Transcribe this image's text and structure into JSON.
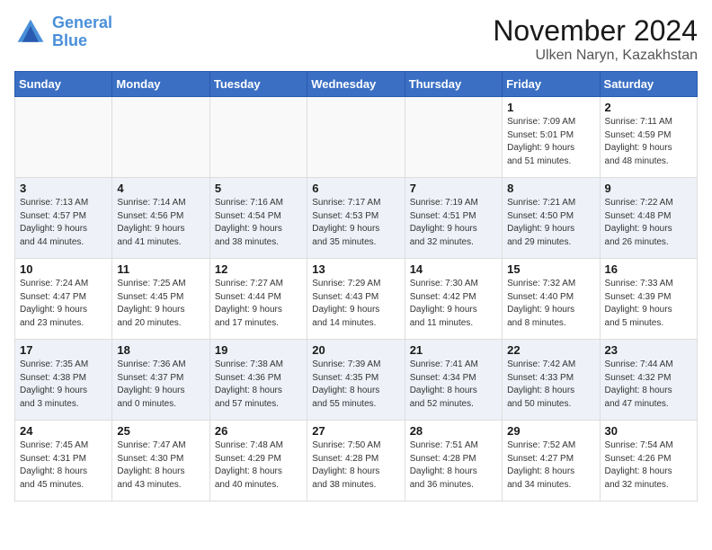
{
  "header": {
    "logo_line1": "General",
    "logo_line2": "Blue",
    "month": "November 2024",
    "location": "Ulken Naryn, Kazakhstan"
  },
  "weekdays": [
    "Sunday",
    "Monday",
    "Tuesday",
    "Wednesday",
    "Thursday",
    "Friday",
    "Saturday"
  ],
  "weeks": [
    [
      {
        "day": "",
        "info": ""
      },
      {
        "day": "",
        "info": ""
      },
      {
        "day": "",
        "info": ""
      },
      {
        "day": "",
        "info": ""
      },
      {
        "day": "",
        "info": ""
      },
      {
        "day": "1",
        "info": "Sunrise: 7:09 AM\nSunset: 5:01 PM\nDaylight: 9 hours\nand 51 minutes."
      },
      {
        "day": "2",
        "info": "Sunrise: 7:11 AM\nSunset: 4:59 PM\nDaylight: 9 hours\nand 48 minutes."
      }
    ],
    [
      {
        "day": "3",
        "info": "Sunrise: 7:13 AM\nSunset: 4:57 PM\nDaylight: 9 hours\nand 44 minutes."
      },
      {
        "day": "4",
        "info": "Sunrise: 7:14 AM\nSunset: 4:56 PM\nDaylight: 9 hours\nand 41 minutes."
      },
      {
        "day": "5",
        "info": "Sunrise: 7:16 AM\nSunset: 4:54 PM\nDaylight: 9 hours\nand 38 minutes."
      },
      {
        "day": "6",
        "info": "Sunrise: 7:17 AM\nSunset: 4:53 PM\nDaylight: 9 hours\nand 35 minutes."
      },
      {
        "day": "7",
        "info": "Sunrise: 7:19 AM\nSunset: 4:51 PM\nDaylight: 9 hours\nand 32 minutes."
      },
      {
        "day": "8",
        "info": "Sunrise: 7:21 AM\nSunset: 4:50 PM\nDaylight: 9 hours\nand 29 minutes."
      },
      {
        "day": "9",
        "info": "Sunrise: 7:22 AM\nSunset: 4:48 PM\nDaylight: 9 hours\nand 26 minutes."
      }
    ],
    [
      {
        "day": "10",
        "info": "Sunrise: 7:24 AM\nSunset: 4:47 PM\nDaylight: 9 hours\nand 23 minutes."
      },
      {
        "day": "11",
        "info": "Sunrise: 7:25 AM\nSunset: 4:45 PM\nDaylight: 9 hours\nand 20 minutes."
      },
      {
        "day": "12",
        "info": "Sunrise: 7:27 AM\nSunset: 4:44 PM\nDaylight: 9 hours\nand 17 minutes."
      },
      {
        "day": "13",
        "info": "Sunrise: 7:29 AM\nSunset: 4:43 PM\nDaylight: 9 hours\nand 14 minutes."
      },
      {
        "day": "14",
        "info": "Sunrise: 7:30 AM\nSunset: 4:42 PM\nDaylight: 9 hours\nand 11 minutes."
      },
      {
        "day": "15",
        "info": "Sunrise: 7:32 AM\nSunset: 4:40 PM\nDaylight: 9 hours\nand 8 minutes."
      },
      {
        "day": "16",
        "info": "Sunrise: 7:33 AM\nSunset: 4:39 PM\nDaylight: 9 hours\nand 5 minutes."
      }
    ],
    [
      {
        "day": "17",
        "info": "Sunrise: 7:35 AM\nSunset: 4:38 PM\nDaylight: 9 hours\nand 3 minutes."
      },
      {
        "day": "18",
        "info": "Sunrise: 7:36 AM\nSunset: 4:37 PM\nDaylight: 9 hours\nand 0 minutes."
      },
      {
        "day": "19",
        "info": "Sunrise: 7:38 AM\nSunset: 4:36 PM\nDaylight: 8 hours\nand 57 minutes."
      },
      {
        "day": "20",
        "info": "Sunrise: 7:39 AM\nSunset: 4:35 PM\nDaylight: 8 hours\nand 55 minutes."
      },
      {
        "day": "21",
        "info": "Sunrise: 7:41 AM\nSunset: 4:34 PM\nDaylight: 8 hours\nand 52 minutes."
      },
      {
        "day": "22",
        "info": "Sunrise: 7:42 AM\nSunset: 4:33 PM\nDaylight: 8 hours\nand 50 minutes."
      },
      {
        "day": "23",
        "info": "Sunrise: 7:44 AM\nSunset: 4:32 PM\nDaylight: 8 hours\nand 47 minutes."
      }
    ],
    [
      {
        "day": "24",
        "info": "Sunrise: 7:45 AM\nSunset: 4:31 PM\nDaylight: 8 hours\nand 45 minutes."
      },
      {
        "day": "25",
        "info": "Sunrise: 7:47 AM\nSunset: 4:30 PM\nDaylight: 8 hours\nand 43 minutes."
      },
      {
        "day": "26",
        "info": "Sunrise: 7:48 AM\nSunset: 4:29 PM\nDaylight: 8 hours\nand 40 minutes."
      },
      {
        "day": "27",
        "info": "Sunrise: 7:50 AM\nSunset: 4:28 PM\nDaylight: 8 hours\nand 38 minutes."
      },
      {
        "day": "28",
        "info": "Sunrise: 7:51 AM\nSunset: 4:28 PM\nDaylight: 8 hours\nand 36 minutes."
      },
      {
        "day": "29",
        "info": "Sunrise: 7:52 AM\nSunset: 4:27 PM\nDaylight: 8 hours\nand 34 minutes."
      },
      {
        "day": "30",
        "info": "Sunrise: 7:54 AM\nSunset: 4:26 PM\nDaylight: 8 hours\nand 32 minutes."
      }
    ]
  ]
}
